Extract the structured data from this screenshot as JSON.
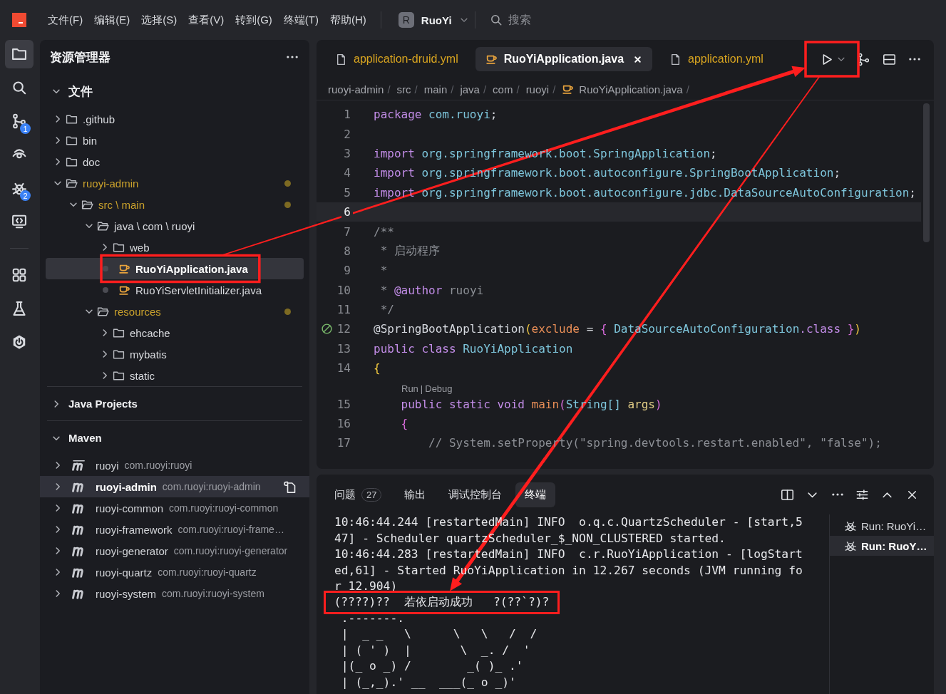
{
  "menu_bar": {
    "items": [
      "文件(F)",
      "编辑(E)",
      "选择(S)",
      "查看(V)",
      "转到(G)",
      "终端(T)",
      "帮助(H)"
    ],
    "profile": {
      "initial": "R",
      "name": "RuoYi"
    },
    "search": {
      "placeholder": "搜索"
    }
  },
  "activity_bar": {
    "top": [
      {
        "kind": "files",
        "selected": true
      },
      {
        "kind": "search",
        "selected": false
      },
      {
        "kind": "source_control",
        "selected": false,
        "badge": "1"
      },
      {
        "kind": "remote",
        "selected": false
      },
      {
        "kind": "debug",
        "selected": false,
        "badge": "2"
      },
      {
        "kind": "remote_window",
        "selected": false
      }
    ],
    "bottom": [
      {
        "kind": "extensions",
        "selected": false
      },
      {
        "kind": "testing",
        "selected": false
      },
      {
        "kind": "spring",
        "selected": false
      }
    ]
  },
  "explorer": {
    "title": "资源管理器",
    "sections": [
      {
        "kind": "files",
        "title": "文件",
        "expanded": true,
        "tree": [
          {
            "name": ".github",
            "kind": "folder",
            "expanded": false,
            "modified": false,
            "selected": false
          },
          {
            "name": "bin",
            "kind": "folder",
            "expanded": false,
            "modified": false,
            "selected": false
          },
          {
            "name": "doc",
            "kind": "folder",
            "expanded": false,
            "modified": false,
            "selected": false
          },
          {
            "name": "ruoyi-admin",
            "kind": "folder",
            "expanded": true,
            "modified": true,
            "selected": false,
            "children": [
              {
                "name": "src \\ main",
                "kind": "folder",
                "expanded": true,
                "modified": true,
                "selected": false,
                "children": [
                  {
                    "name": "java \\ com \\ ruoyi",
                    "kind": "folder",
                    "expanded": true,
                    "modified": false,
                    "selected": false,
                    "children": [
                      {
                        "name": "web",
                        "kind": "folder",
                        "expanded": false,
                        "modified": false,
                        "selected": false
                      },
                      {
                        "name": "RuoYiApplication.java",
                        "kind": "java",
                        "modified": false,
                        "selected": true
                      },
                      {
                        "name": "RuoYiServletInitializer.java",
                        "kind": "java",
                        "modified": false,
                        "selected": false
                      }
                    ]
                  },
                  {
                    "name": "resources",
                    "kind": "folder",
                    "expanded": true,
                    "modified": true,
                    "selected": false,
                    "children": [
                      {
                        "name": "ehcache",
                        "kind": "folder",
                        "expanded": false,
                        "modified": false,
                        "selected": false
                      },
                      {
                        "name": "mybatis",
                        "kind": "folder",
                        "expanded": false,
                        "modified": false,
                        "selected": false
                      },
                      {
                        "name": "static",
                        "kind": "folder",
                        "expanded": false,
                        "modified": false,
                        "selected": false
                      }
                    ]
                  }
                ]
              }
            ]
          }
        ]
      },
      {
        "kind": "plain",
        "title": "Java Projects",
        "expanded": false
      },
      {
        "kind": "maven",
        "title": "Maven",
        "expanded": true,
        "items": [
          {
            "name": "ruoyi",
            "coordinates": "com.ruoyi:ruoyi",
            "kind": "parent",
            "selected": false
          },
          {
            "name": "ruoyi-admin",
            "coordinates": "com.ruoyi:ruoyi-admin",
            "kind": "module",
            "selected": true
          },
          {
            "name": "ruoyi-common",
            "coordinates": "com.ruoyi:ruoyi-common",
            "kind": "module",
            "selected": false
          },
          {
            "name": "ruoyi-framework",
            "coordinates": "com.ruoyi:ruoyi-frame…",
            "kind": "module",
            "selected": false
          },
          {
            "name": "ruoyi-generator",
            "coordinates": "com.ruoyi:ruoyi-generator",
            "kind": "module",
            "selected": false
          },
          {
            "name": "ruoyi-quartz",
            "coordinates": "com.ruoyi:ruoyi-quartz",
            "kind": "module",
            "selected": false
          },
          {
            "name": "ruoyi-system",
            "coordinates": "com.ruoyi:ruoyi-system",
            "kind": "module",
            "selected": false
          }
        ]
      }
    ]
  },
  "editor": {
    "tabs": [
      {
        "label": "application-druid.yml",
        "kind": "file",
        "modified": true,
        "selected": false
      },
      {
        "label": "RuoYiApplication.java",
        "kind": "java",
        "modified": false,
        "selected": true
      },
      {
        "label": "application.yml",
        "kind": "file",
        "modified": true,
        "selected": false
      }
    ],
    "breadcrumb": {
      "separator": "/",
      "items": [
        {
          "label": "ruoyi-admin",
          "kind": "folder"
        },
        {
          "label": "src",
          "kind": "folder"
        },
        {
          "label": "main",
          "kind": "folder"
        },
        {
          "label": "java",
          "kind": "folder"
        },
        {
          "label": "com",
          "kind": "folder"
        },
        {
          "label": "ruoyi",
          "kind": "folder"
        },
        {
          "label": "RuoYiApplication.java",
          "kind": "java"
        }
      ]
    },
    "lines": [
      {
        "kind": "code",
        "number": "1",
        "tokens": [
          {
            "kind": "kw",
            "text": "package"
          },
          {
            "kind": "ns",
            "text": " com.ruoyi"
          },
          {
            "kind": "p",
            "text": ";"
          }
        ]
      },
      {
        "kind": "code",
        "number": "2"
      },
      {
        "kind": "code",
        "number": "3",
        "tokens": [
          {
            "kind": "kw",
            "text": "import"
          },
          {
            "kind": "ns",
            "text": " org.springframework.boot.SpringApplication"
          },
          {
            "kind": "p",
            "text": ";"
          }
        ]
      },
      {
        "kind": "code",
        "number": "4",
        "tokens": [
          {
            "kind": "kw",
            "text": "import"
          },
          {
            "kind": "ns",
            "text": " org.springframework.boot.autoconfigure.SpringBootApplication"
          },
          {
            "kind": "p",
            "text": ";"
          }
        ]
      },
      {
        "kind": "code",
        "number": "5",
        "tokens": [
          {
            "kind": "kw",
            "text": "import"
          },
          {
            "kind": "ns",
            "text": " org.springframework.boot.autoconfigure.jdbc.DataSourceAutoConfiguration"
          },
          {
            "kind": "p",
            "text": ";"
          }
        ]
      },
      {
        "kind": "code",
        "number": "6",
        "current": true
      },
      {
        "kind": "code",
        "number": "7",
        "tokens": [
          {
            "kind": "cm",
            "text": "/**"
          }
        ]
      },
      {
        "kind": "code",
        "number": "8",
        "tokens": [
          {
            "kind": "cm",
            "text": " * 启动程序"
          }
        ]
      },
      {
        "kind": "code",
        "number": "9",
        "tokens": [
          {
            "kind": "cm",
            "text": " *"
          }
        ]
      },
      {
        "kind": "code",
        "number": "10",
        "tokens": [
          {
            "kind": "cm",
            "text": " * "
          },
          {
            "kind": "kw",
            "text": "@author"
          },
          {
            "kind": "cm",
            "text": " ruoyi"
          }
        ]
      },
      {
        "kind": "code",
        "number": "11",
        "tokens": [
          {
            "kind": "cm",
            "text": " */"
          }
        ]
      },
      {
        "kind": "code",
        "number": "12",
        "gutter_mark": true,
        "tokens": [
          {
            "kind": "p",
            "text": "@SpringBootApplication"
          },
          {
            "kind": "br",
            "text": "("
          },
          {
            "kind": "fn",
            "text": "exclude"
          },
          {
            "kind": "p",
            "text": " = "
          },
          {
            "kind": "br2",
            "text": "{"
          },
          {
            "kind": "ty",
            "text": " DataSourceAutoConfiguration"
          },
          {
            "kind": "kw",
            "text": ".class"
          },
          {
            "kind": "br2",
            "text": " }"
          },
          {
            "kind": "br",
            "text": ")"
          }
        ]
      },
      {
        "kind": "code",
        "number": "13",
        "tokens": [
          {
            "kind": "kw",
            "text": "public class"
          },
          {
            "kind": "ty",
            "text": " RuoYiApplication"
          }
        ]
      },
      {
        "kind": "code",
        "number": "14",
        "tokens": [
          {
            "kind": "br",
            "text": "{"
          }
        ]
      },
      {
        "kind": "codelens",
        "items": [
          "Run",
          "Debug"
        ],
        "separator": "|"
      },
      {
        "kind": "code",
        "number": "15",
        "tokens": [
          {
            "kind": "kw",
            "text": "    public static void"
          },
          {
            "kind": "fn",
            "text": " main"
          },
          {
            "kind": "br2",
            "text": "("
          },
          {
            "kind": "ty",
            "text": "String[]"
          },
          {
            "kind": "pa",
            "text": " args"
          },
          {
            "kind": "br2",
            "text": ")"
          }
        ]
      },
      {
        "kind": "code",
        "number": "16",
        "tokens": [
          {
            "kind": "br2",
            "text": "    {"
          }
        ]
      },
      {
        "kind": "code",
        "number": "17",
        "tokens": [
          {
            "kind": "cm",
            "text": "        // System.setProperty(\"spring.devtools.restart.enabled\", \"false\");"
          }
        ]
      }
    ]
  },
  "panel": {
    "tabs": [
      {
        "label": "问题",
        "badge": "27",
        "selected": false
      },
      {
        "label": "输出",
        "selected": false
      },
      {
        "label": "调试控制台",
        "selected": false
      },
      {
        "label": "终端",
        "selected": true
      }
    ],
    "terminal": {
      "lines": [
        {
          "text": "10:46:44.244 [restartedMain] INFO  o.q.c.QuartzScheduler - [start,5"
        },
        {
          "text": "47] - Scheduler quartzScheduler_$_NON_CLUSTERED started."
        },
        {
          "text": "10:46:44.283 [restartedMain] INFO  c.r.RuoYiApplication - [logStart"
        },
        {
          "text": "ed,61] - Started RuoYiApplication in 12.267 seconds (JVM running fo"
        },
        {
          "text": "r 12.904)"
        },
        {
          "text": "(????)??  若依启动成功   ?(??`?)?",
          "boxed": true
        },
        {
          "text": " .-------."
        },
        {
          "text": " |  _ _   \\      \\   \\   /  /"
        },
        {
          "text": " | ( ' )  |       \\  _. /  '"
        },
        {
          "text": " |(_ o _) /        _( )_ .'"
        },
        {
          "text": " | (_,_).' __  ___(_ o _)'"
        }
      ]
    },
    "sessions": [
      {
        "label": "Run: RuoYi…",
        "selected": false
      },
      {
        "label": "Run: RuoY…",
        "selected": true
      }
    ]
  },
  "annotations": {
    "boxes": [
      {
        "kind": "selected_file",
        "arrow_to_next": true
      },
      {
        "kind": "run_action",
        "arrow_to_next": true
      },
      {
        "kind": "boxed_terminal_line"
      }
    ]
  }
}
